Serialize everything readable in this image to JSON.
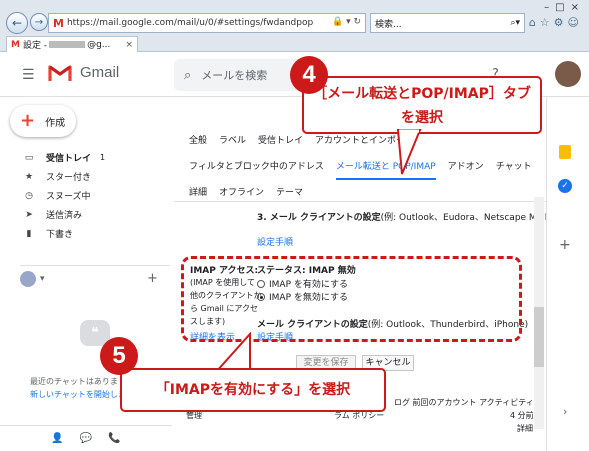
{
  "browser": {
    "url": "https://mail.google.com/mail/u/0/#settings/fwdandpop",
    "search_placeholder": "検索...",
    "tab_title_prefix": "設定 -",
    "tab_title_suffix": "@g..."
  },
  "gmail": {
    "logo_text": "Gmail",
    "search_placeholder": "メールを検索",
    "compose_label": "作成",
    "nav": [
      {
        "label": "受信トレイ",
        "count": "1",
        "icon": "inbox-icon"
      },
      {
        "label": "スター付き",
        "icon": "star-icon"
      },
      {
        "label": "スヌーズ中",
        "icon": "clock-icon"
      },
      {
        "label": "送信済み",
        "icon": "send-icon"
      },
      {
        "label": "下書き",
        "icon": "draft-icon"
      }
    ],
    "chat_empty": "最近のチャットはありま",
    "chat_link": "新しいチャットを開始しま"
  },
  "settings": {
    "tabs_row1": [
      "全般",
      "ラベル",
      "受信トレイ",
      "アカウントとインポート"
    ],
    "tabs_row2": [
      "フィルタとブロック中のアドレス",
      "メール転送と POP/IMAP",
      "アドオン",
      "チャット"
    ],
    "tabs_row3": [
      "詳細",
      "オフライン",
      "テーマ"
    ],
    "pop_client_title": "3. メール クライアントの設定",
    "pop_client_desc": "(例: Outlook、Eudora、Netscape Mail)",
    "setup_link": "設定手順",
    "imap_label": "IMAP アクセス:",
    "imap_status": "ステータス: IMAP 無効",
    "imap_desc": [
      "(IMAP を使用して",
      "他のクライアントか",
      "ら Gmail にアクセ",
      "スします)"
    ],
    "imap_details_link": "詳細を表示",
    "radio_enable": "IMAP を有効にする",
    "radio_disable": "IMAP を無効にする",
    "imap_client_title": "メール クライアントの設定",
    "imap_client_desc": "(例: Outlook、Thunderbird、iPhone)",
    "imap_setup_link": "設定手順",
    "save_button": "変更を保存",
    "cancel_button": "キャンセル",
    "footer_activity": "ログ  前回のアカウント アクティビティ:",
    "footer_time": "4 分前",
    "footer_details": "詳細",
    "footer_policy": "ラム ポリシー",
    "footer_manage": "管理"
  },
  "callouts": {
    "step4_number": "4",
    "step4_text": "［メール転送とPOP/IMAP］タブを選択",
    "step5_number": "5",
    "step5_text": "「IMAPを有効にする」を選択"
  },
  "colors": {
    "callout_red": "#cc1a1a",
    "gmail_blue": "#1a73e8"
  }
}
